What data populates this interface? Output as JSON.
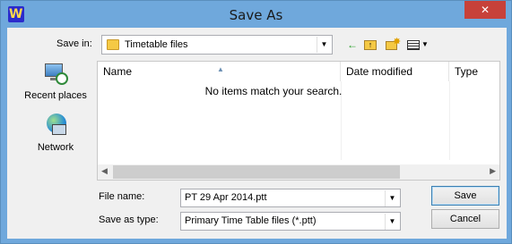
{
  "window": {
    "title": "Save As",
    "app_icon": "W",
    "close_glyph": "✕"
  },
  "save_in": {
    "label": "Save in:",
    "value": "Timetable files"
  },
  "toolbar": {
    "back_icon": "←",
    "up_icon": "↑"
  },
  "places": [
    {
      "label": "Recent places",
      "icon": "recent-places-icon"
    },
    {
      "label": "Network",
      "icon": "network-icon"
    }
  ],
  "file_list": {
    "columns": [
      "Name",
      "Date modified",
      "Type"
    ],
    "empty_message": "No items match your search."
  },
  "file_name": {
    "label": "File name:",
    "value": "PT 29 Apr 2014.ptt"
  },
  "save_as_type": {
    "label": "Save as type:",
    "value": "Primary Time Table files (*.ptt)"
  },
  "buttons": {
    "save": "Save",
    "cancel": "Cancel"
  },
  "colors": {
    "titlebar": "#6fa8dc",
    "close": "#c7413a",
    "dialog_bg": "#f0f0f0"
  }
}
